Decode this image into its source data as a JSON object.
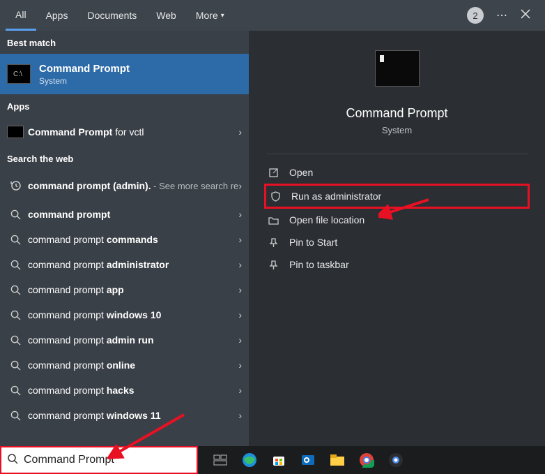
{
  "header": {
    "tabs": [
      {
        "label": "All",
        "active": true
      },
      {
        "label": "Apps",
        "active": false
      },
      {
        "label": "Documents",
        "active": false
      },
      {
        "label": "Web",
        "active": false
      },
      {
        "label": "More",
        "active": false,
        "dropdown": true
      }
    ],
    "badge": "2"
  },
  "sections": {
    "best_match": "Best match",
    "apps": "Apps",
    "web": "Search the web"
  },
  "best_match": {
    "title": "Command Prompt",
    "subtitle": "System"
  },
  "apps": [
    {
      "prefix": "Command Prompt",
      "suffix": " for vctl"
    }
  ],
  "web_results": [
    {
      "icon": "history",
      "bold_pre": "command prompt (admin).",
      "muted": " - See more search results"
    },
    {
      "icon": "search",
      "bold_pre": "command prompt",
      "norm": ""
    },
    {
      "icon": "search",
      "norm": "command prompt ",
      "bold": "commands"
    },
    {
      "icon": "search",
      "norm": "command prompt ",
      "bold": "administrator"
    },
    {
      "icon": "search",
      "norm": "command prompt ",
      "bold": "app"
    },
    {
      "icon": "search",
      "norm": "command prompt ",
      "bold": "windows 10"
    },
    {
      "icon": "search",
      "norm": "command prompt ",
      "bold": "admin run"
    },
    {
      "icon": "search",
      "norm": "command prompt ",
      "bold": "online"
    },
    {
      "icon": "search",
      "norm": "command prompt ",
      "bold": "hacks"
    },
    {
      "icon": "search",
      "norm": "command prompt ",
      "bold": "windows 11"
    }
  ],
  "preview": {
    "title": "Command Prompt",
    "subtitle": "System",
    "actions": [
      {
        "icon": "open",
        "label": "Open",
        "highlight": false
      },
      {
        "icon": "shield",
        "label": "Run as administrator",
        "highlight": true
      },
      {
        "icon": "folder",
        "label": "Open file location",
        "highlight": false
      },
      {
        "icon": "pin",
        "label": "Pin to Start",
        "highlight": false
      },
      {
        "icon": "pin",
        "label": "Pin to taskbar",
        "highlight": false
      }
    ]
  },
  "searchbox": {
    "value": "Command Prompt"
  },
  "colors": {
    "accent": "#2c6aa8",
    "highlight": "#e81123"
  }
}
